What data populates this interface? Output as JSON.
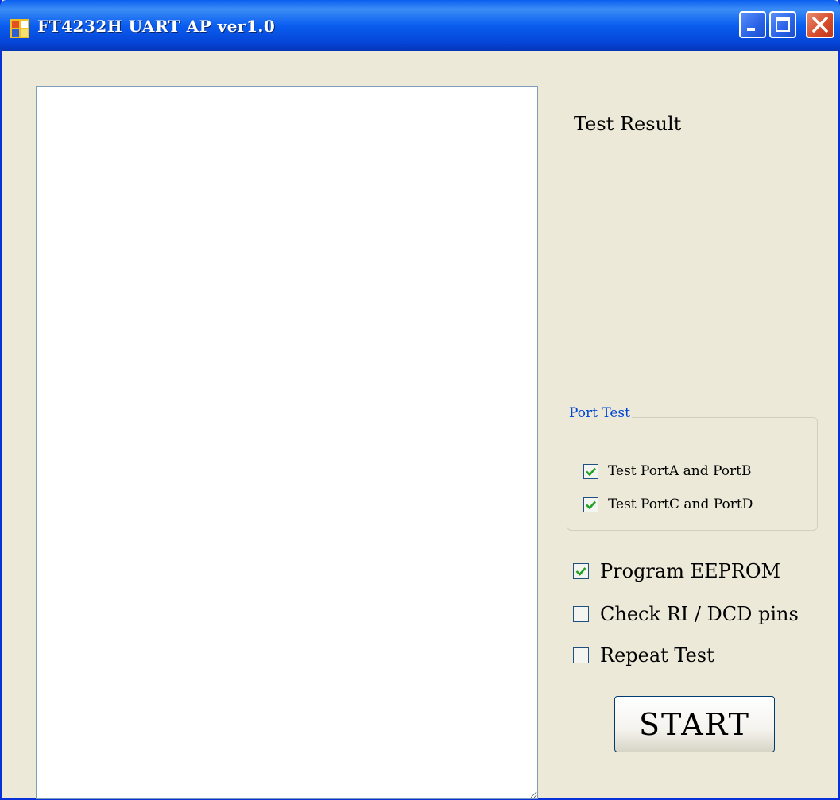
{
  "window": {
    "title": "FT4232H UART AP ver1.0",
    "icon": "app-window-icon",
    "controls": [
      "minimize-icon",
      "maximize-icon",
      "close-icon"
    ]
  },
  "log_area": {
    "value": ""
  },
  "test_result": {
    "label": "Test Result"
  },
  "port_test": {
    "title": "Port Test",
    "options": [
      {
        "label": "Test PortA and PortB",
        "checked": true
      },
      {
        "label": "Test PortC and PortD",
        "checked": true
      }
    ]
  },
  "options": [
    {
      "label": "Program EEPROM",
      "checked": true
    },
    {
      "label": "Check RI / DCD pins",
      "checked": false
    },
    {
      "label": "Repeat Test",
      "checked": false
    }
  ],
  "start_button": {
    "label": "START"
  },
  "colors": {
    "title_bar": "#0a5ef0",
    "window_background": "#ece9d8",
    "group_title": "#0046d5",
    "check_mark": "#21a121"
  }
}
